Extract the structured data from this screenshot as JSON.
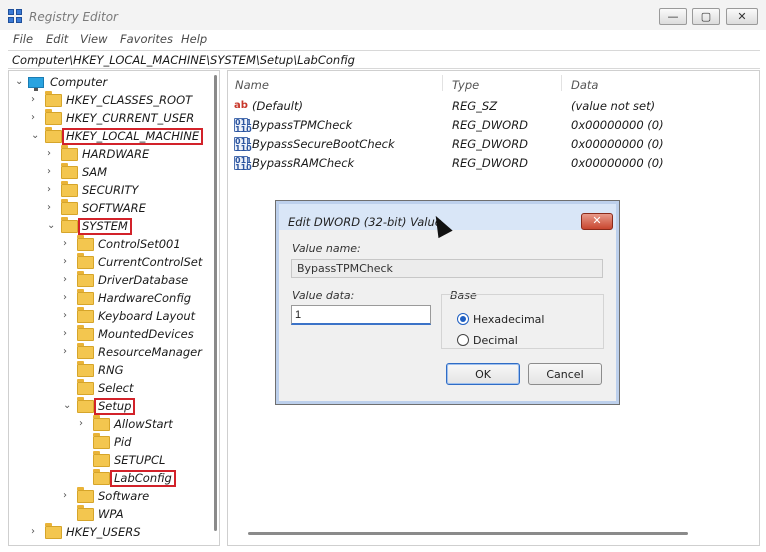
{
  "window": {
    "title": "Registry Editor"
  },
  "menu": {
    "items": [
      "File",
      "Edit",
      "View",
      "Favorites",
      "Help"
    ]
  },
  "address": {
    "path": "Computer\\HKEY_LOCAL_MACHINE\\SYSTEM\\Setup\\LabConfig"
  },
  "tree": {
    "items": [
      {
        "label": "Computer",
        "expanded": true,
        "highlighted": false
      },
      {
        "label": "HKEY_CLASSES_ROOT",
        "expanded": false,
        "highlighted": false
      },
      {
        "label": "HKEY_CURRENT_USER",
        "expanded": false,
        "highlighted": false
      },
      {
        "label": "HKEY_LOCAL_MACHINE",
        "expanded": true,
        "highlighted": true
      },
      {
        "label": "HARDWARE",
        "expanded": false,
        "highlighted": false
      },
      {
        "label": "SAM",
        "expanded": false,
        "highlighted": false
      },
      {
        "label": "SECURITY",
        "expanded": false,
        "highlighted": false
      },
      {
        "label": "SOFTWARE",
        "expanded": false,
        "highlighted": false
      },
      {
        "label": "SYSTEM",
        "expanded": true,
        "highlighted": true
      },
      {
        "label": "ControlSet001",
        "expanded": false,
        "highlighted": false
      },
      {
        "label": "CurrentControlSet",
        "expanded": false,
        "highlighted": false
      },
      {
        "label": "DriverDatabase",
        "expanded": false,
        "highlighted": false
      },
      {
        "label": "HardwareConfig",
        "expanded": false,
        "highlighted": false
      },
      {
        "label": "Keyboard Layout",
        "expanded": false,
        "highlighted": false
      },
      {
        "label": "MountedDevices",
        "expanded": false,
        "highlighted": false
      },
      {
        "label": "ResourceManager",
        "expanded": false,
        "highlighted": false
      },
      {
        "label": "RNG",
        "expanded": false,
        "highlighted": false
      },
      {
        "label": "Select",
        "expanded": false,
        "highlighted": false
      },
      {
        "label": "Setup",
        "expanded": true,
        "highlighted": true
      },
      {
        "label": "AllowStart",
        "expanded": false,
        "highlighted": false
      },
      {
        "label": "Pid",
        "expanded": false,
        "highlighted": false
      },
      {
        "label": "SETUPCL",
        "expanded": false,
        "highlighted": false
      },
      {
        "label": "LabConfig",
        "expanded": false,
        "highlighted": true
      },
      {
        "label": "Software",
        "expanded": false,
        "highlighted": false
      },
      {
        "label": "WPA",
        "expanded": false,
        "highlighted": false
      },
      {
        "label": "HKEY_USERS",
        "expanded": false,
        "highlighted": false
      }
    ]
  },
  "list": {
    "columns": {
      "name": "Name",
      "type": "Type",
      "data": "Data"
    },
    "rows": [
      {
        "icon": "string-value-icon",
        "icon_text": "ab",
        "name": "(Default)",
        "type": "REG_SZ",
        "data": "(value not set)"
      },
      {
        "icon": "binary-value-icon",
        "icon_text": "011\n110",
        "name": "BypassTPMCheck",
        "type": "REG_DWORD",
        "data": "0x00000000 (0)"
      },
      {
        "icon": "binary-value-icon",
        "icon_text": "011\n110",
        "name": "BypassSecureBootCheck",
        "type": "REG_DWORD",
        "data": "0x00000000 (0)"
      },
      {
        "icon": "binary-value-icon",
        "icon_text": "011\n110",
        "name": "BypassRAMCheck",
        "type": "REG_DWORD",
        "data": "0x00000000 (0)"
      }
    ]
  },
  "dialog": {
    "title": "Edit DWORD (32-bit) Value",
    "close_glyph": "✕",
    "value_name_label": "Value name:",
    "value_name": "BypassTPMCheck",
    "value_data_label": "Value data:",
    "value_data": "1",
    "base_label": "Base",
    "hex_label": "Hexadecimal",
    "dec_label": "Decimal",
    "selected_base": "hex",
    "ok_label": "OK",
    "cancel_label": "Cancel"
  },
  "window_controls": {
    "min": "—",
    "max": "▢",
    "close": "✕"
  },
  "colors": {
    "highlight_box": "#d2222a",
    "folder": "#f3c64f",
    "accent": "#1f5fc2"
  }
}
